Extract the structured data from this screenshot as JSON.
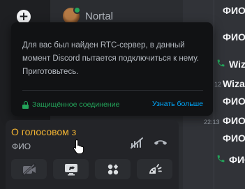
{
  "chat": {
    "lines": [
      {
        "text": "ФИО"
      },
      {
        "text": "ФИО"
      },
      {
        "text": "Wiza"
      },
      {
        "text": "Wiza"
      },
      {
        "text": "ФИО"
      },
      {
        "text": "ФИО"
      },
      {
        "text": "ФИО"
      }
    ],
    "timestamps": [
      "12",
      "22:13"
    ]
  },
  "channel": {
    "member_name": "Nortal"
  },
  "popover": {
    "body": "Для вас был найден RTC-сервер, в данный момент Discord пытается подключиться к нему. Приготовьтесь.",
    "secure_label": "Защищённое соединение",
    "learn_more": "Узнать больше"
  },
  "voice_panel": {
    "title": "О голосовом з",
    "subtitle": "ФИО"
  },
  "colors": {
    "accent_warning": "#f0b232",
    "success": "#23a55a",
    "link": "#00a8fc"
  },
  "icons": [
    "plus-icon",
    "screen-share-off-icon",
    "disconnect-phone-icon",
    "camera-off-icon",
    "screen-share-icon",
    "activities-icon",
    "soundboard-icon",
    "phone-icon",
    "lock-icon",
    "hand-cursor-icon"
  ]
}
